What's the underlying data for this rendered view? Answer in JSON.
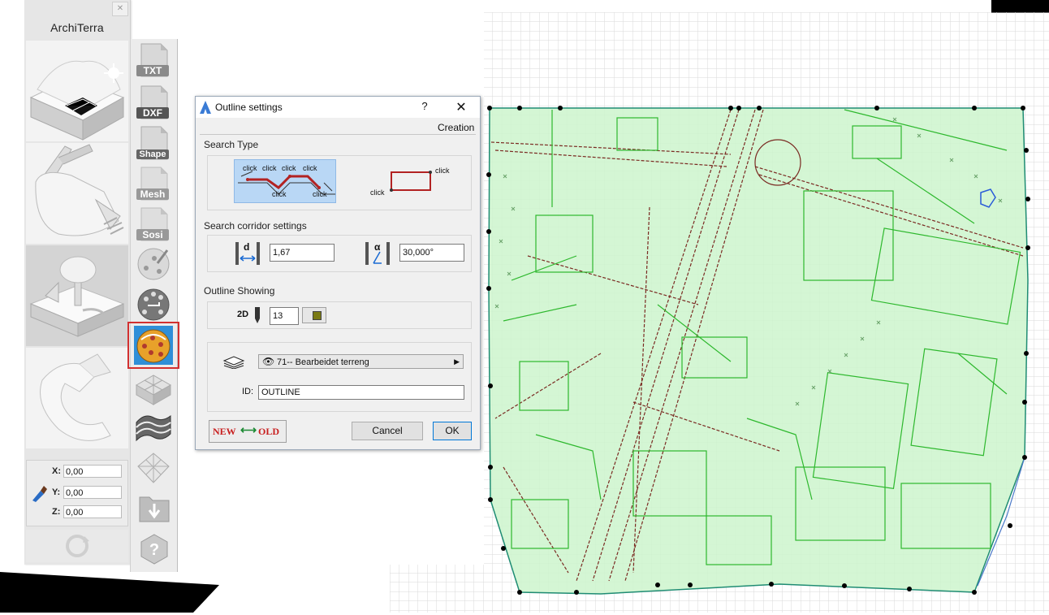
{
  "palette": {
    "panel": "#e6e6e6",
    "accent_red": "#d23030",
    "green_line": "#2db82d",
    "green_fill": "#ccf5cc",
    "brown_line": "#7a2a22",
    "grid": "#d9d9d9",
    "boundary": "#1f8c73"
  },
  "left_panel": {
    "brand": "ArchiTerra",
    "close_icon": "close-icon",
    "tools": [
      "terrain-mesh-tool",
      "excavator-tool",
      "site-landscape-tool",
      "settings-wrench-tool"
    ],
    "coords": [
      {
        "label": "X:",
        "value": "0,00"
      },
      {
        "label": "Y:",
        "value": "0,00"
      },
      {
        "label": "Z:",
        "value": "0,00"
      }
    ]
  },
  "toolbar": {
    "files": [
      {
        "label": "TXT"
      },
      {
        "label": "DXF"
      },
      {
        "label": "Shape"
      },
      {
        "label": "Mesh"
      },
      {
        "label": "Sosi"
      }
    ]
  },
  "dialog": {
    "title": "Outline settings",
    "help": "?",
    "close": "✕",
    "tab": "Creation",
    "search_type": {
      "title": "Search Type",
      "click_label": "click"
    },
    "corridor": {
      "title": "Search corridor settings",
      "distance_symbol": "d",
      "distance_value": "1,67",
      "angle_symbol": "α",
      "angle_value": "30,000°"
    },
    "outline": {
      "title": "Outline Showing",
      "mode": "2D",
      "pen_value": "13"
    },
    "layer": {
      "value": "71-- Bearbeidet terreng"
    },
    "id_label": "ID:",
    "id_value": "OUTLINE",
    "new_old": {
      "new": "NEW",
      "old": "OLD"
    },
    "cancel": "Cancel",
    "ok": "OK"
  }
}
